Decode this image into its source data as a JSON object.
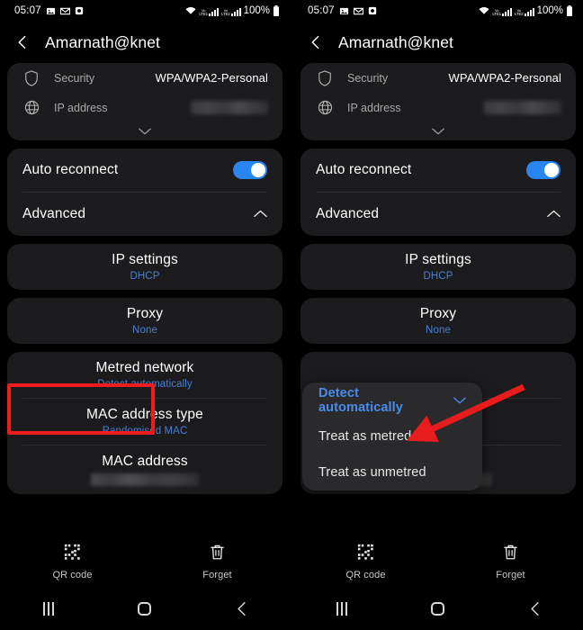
{
  "statusbar": {
    "time": "05:07",
    "icons": [
      "photo-icon",
      "gmail-icon",
      "camera-icon"
    ],
    "wifi_icon": "wifi-icon",
    "sim1_label_top": "Vo",
    "sim1_label_bottom": "LTE1",
    "sim2_label_top": "Vo",
    "sim2_label_bottom": "LTE2",
    "battery": "100%",
    "battery_icon": "battery-full-icon"
  },
  "header": {
    "back_icon": "back-chevron-icon",
    "title": "Amarnath@knet"
  },
  "info_card": {
    "rows": [
      {
        "icon": "shield-icon",
        "label": "Security",
        "value": "WPA/WPA2-Personal",
        "redacted": false
      },
      {
        "icon": "globe-icon",
        "label": "IP address",
        "value": "",
        "redacted": true
      }
    ],
    "expand_icon": "chevron-down-icon"
  },
  "settings_card": {
    "auto_reconnect": {
      "label": "Auto reconnect",
      "toggle_on": true
    },
    "advanced": {
      "label": "Advanced",
      "chevron": "chevron-up-icon"
    }
  },
  "items": [
    {
      "title": "IP settings",
      "sub": "DHCP"
    },
    {
      "title": "Proxy",
      "sub": "None"
    }
  ],
  "grouped_card": [
    {
      "title": "Metred network",
      "sub": "Detect automatically",
      "highlighted": true
    },
    {
      "title": "MAC address type",
      "sub": "Randomised MAC",
      "highlighted": false
    },
    {
      "title": "MAC address",
      "sub": "",
      "redacted": true,
      "highlighted": false
    }
  ],
  "dropdown": {
    "options": [
      {
        "label": "Detect automatically",
        "selected": true,
        "chevron": "chevron-down-icon"
      },
      {
        "label": "Treat as metred",
        "selected": false
      },
      {
        "label": "Treat as unmetred",
        "selected": false
      }
    ]
  },
  "actionbar": [
    {
      "icon": "qr-code-icon",
      "label": "QR code"
    },
    {
      "icon": "trash-icon",
      "label": "Forget"
    }
  ],
  "navbar": [
    {
      "icon": "recents-icon"
    },
    {
      "icon": "home-icon"
    },
    {
      "icon": "back-icon"
    }
  ],
  "annotations": {
    "highlight_color": "#ee1c1c",
    "arrow_color": "#e81c1c",
    "accent_color": "#4a7fd4",
    "toggle_color": "#2986f0"
  }
}
